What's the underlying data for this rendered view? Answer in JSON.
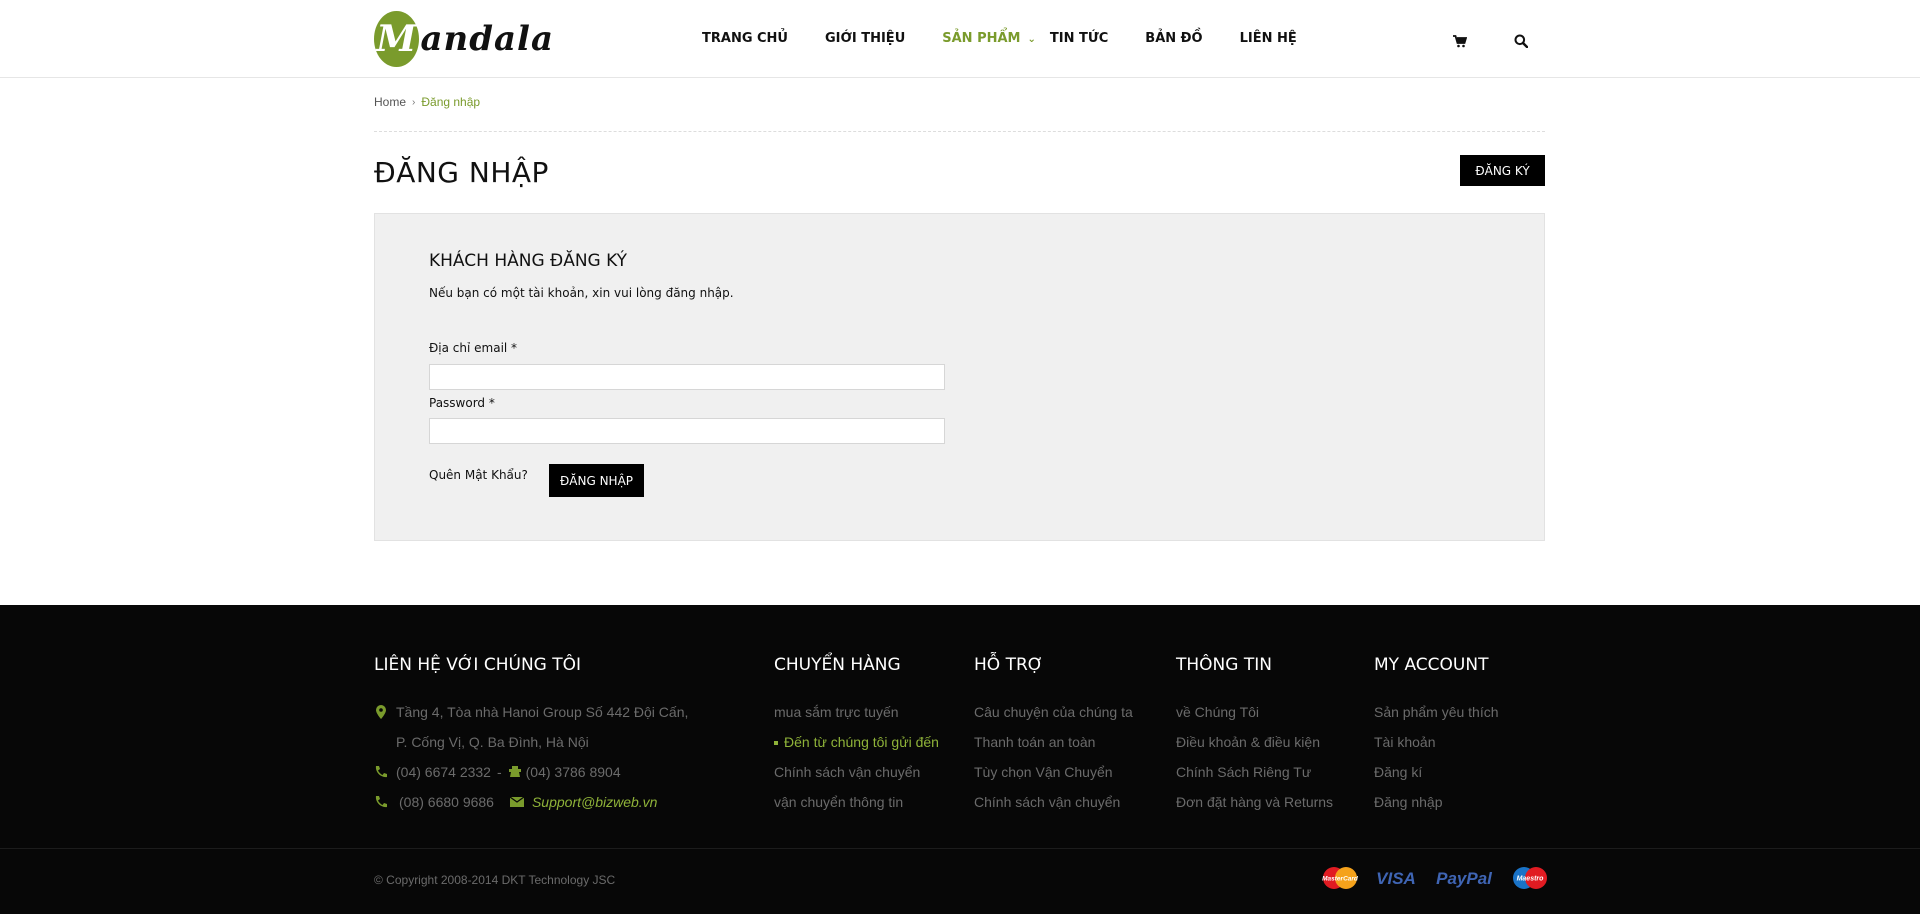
{
  "header": {
    "logo_letter": "M",
    "logo_text": "andala",
    "nav": [
      {
        "label": "TRANG CHỦ"
      },
      {
        "label": "GIỚI THIỆU"
      },
      {
        "label": "SẢN PHẨM"
      },
      {
        "label": "TIN TỨC"
      },
      {
        "label": "BẢN ĐỒ"
      },
      {
        "label": "LIÊN HỆ"
      }
    ],
    "cart_icon": "cart-icon",
    "search_icon": "search-icon"
  },
  "breadcrumb": {
    "home": "Home",
    "current": "Đăng nhập"
  },
  "page": {
    "title": "ĐĂNG NHẬP",
    "register_button": "ĐĂNG KÝ"
  },
  "login_panel": {
    "title": "KHÁCH HÀNG ĐĂNG KÝ",
    "description": "Nếu bạn có một tài khoản, xin vui lòng đăng nhập.",
    "email_label": "Địa chỉ email *",
    "email_value": "",
    "password_label": "Password *",
    "password_value": "",
    "forgot_label": "Quên Mật Khẩu?",
    "login_button": "ĐĂNG NHẬP"
  },
  "footer": {
    "contact": {
      "title": "LIÊN HỆ VỚI CHÚNG TÔI",
      "address_line1": "Tầng 4, Tòa nhà Hanoi Group  Số 442 Đội Cấn,",
      "address_line2": "P. Cống Vị, Q. Ba Đình, Hà Nội",
      "phone1": "(04) 6674 2332",
      "phone_sep": "-",
      "phone2": "(04) 3786 8904",
      "phone3": "(08) 6680 9686",
      "email": "Support@bizweb.vn"
    },
    "columns": [
      {
        "title": "CHUYỂN HÀNG",
        "links": [
          "mua sắm trực tuyến",
          "Đến từ chúng tôi gửi đến",
          "Chính sách vận chuyển",
          "vận chuyển thông tin"
        ]
      },
      {
        "title": "HỖ TRỢ",
        "links": [
          "Câu chuyện của chúng ta",
          "Thanh toán an toàn",
          "Tùy chọn Vận Chuyển",
          "Chính sách vận chuyển"
        ]
      },
      {
        "title": "THÔNG TIN",
        "links": [
          "về Chúng Tôi",
          "Điều khoản & điều kiện",
          "Chính Sách Riêng Tư",
          "Đơn đặt hàng và Returns"
        ]
      },
      {
        "title": "MY ACCOUNT",
        "links": [
          "Sản phẩm yêu thích",
          "Tài khoản",
          "Đăng kí",
          "Đăng nhập"
        ]
      }
    ],
    "copyright": "© Copyright 2008-2014 DKT Technology JSC",
    "payments": {
      "mastercard": "MasterCard",
      "visa": "VISA",
      "paypal": "PayPal",
      "maestro": "Maestro"
    }
  },
  "colors": {
    "accent": "#7a9b2c",
    "footer_bg": "#070707"
  }
}
